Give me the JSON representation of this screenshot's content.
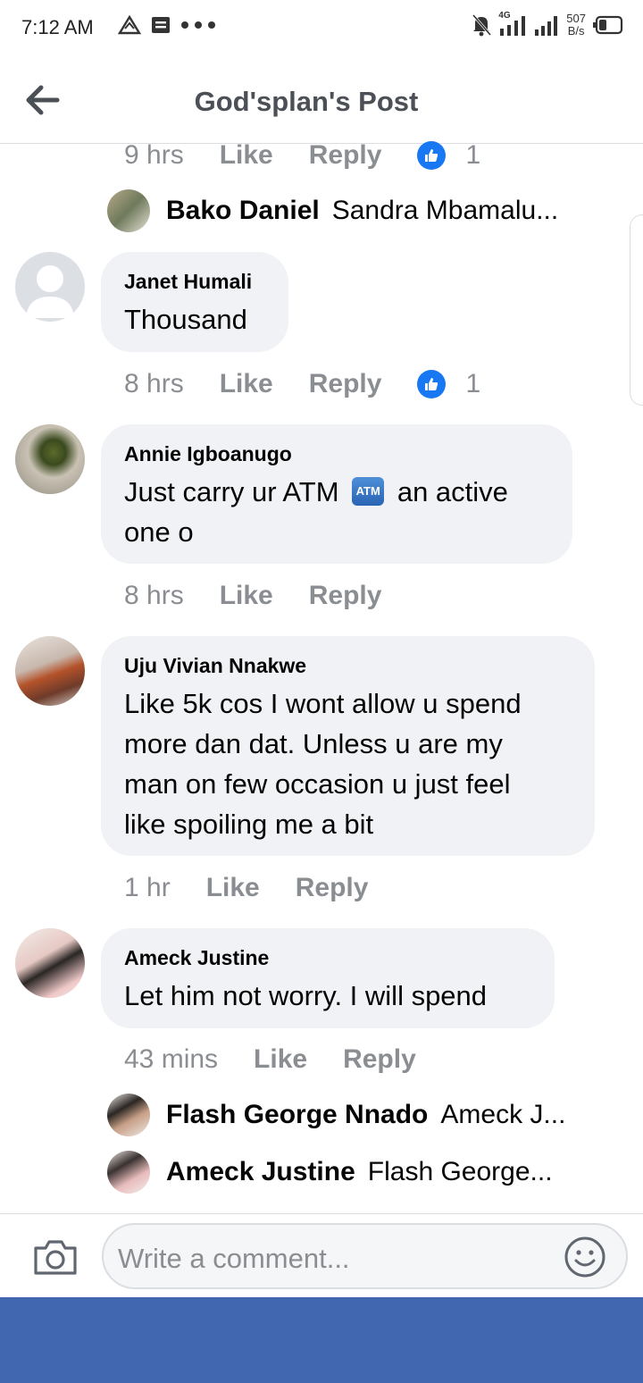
{
  "status_bar": {
    "time": "7:12 AM",
    "network_label": "4G",
    "net_speed_value": "507",
    "net_speed_unit": "B/s"
  },
  "header": {
    "title": "God'splan's Post"
  },
  "comments": [
    {
      "time": "9 hrs",
      "like": "Like",
      "reply": "Reply",
      "reaction_count": "1"
    },
    {
      "name": "Janet Humali",
      "text": "Thousand",
      "time": "8 hrs",
      "like": "Like",
      "reply": "Reply",
      "reaction_count": "1"
    },
    {
      "name": "Annie Igboanugo",
      "text_before": "Just  carry ur ATM",
      "emoji_label": "ATM",
      "text_after": "an active",
      "text_line2": "one o",
      "time": "8 hrs",
      "like": "Like",
      "reply": "Reply"
    },
    {
      "name": "Uju Vivian Nnakwe",
      "lines": [
        "Like 5k  cos  I wont allow u spend",
        "more  dan dat. Unless u are my",
        "man on few occasion  u just feel",
        "like spoiling  me  a bit"
      ],
      "time": "1 hr",
      "like": "Like",
      "reply": "Reply"
    },
    {
      "name": "Ameck Justine",
      "text": "Let him not worry. I will spend",
      "time": "43 mins",
      "like": "Like",
      "reply": "Reply"
    }
  ],
  "replies": [
    {
      "name": "Bako Daniel",
      "preview": "Sandra Mbamalu..."
    },
    {
      "name": "Flash George Nnado",
      "preview": "Ameck J..."
    },
    {
      "name": "Ameck Justine",
      "preview": "Flash George..."
    }
  ],
  "composer": {
    "placeholder": "Write a comment..."
  },
  "colors": {
    "facebook_blue": "#1877f2",
    "bubble_bg": "#f0f2f5",
    "nav_bar": "#4167b1",
    "meta_gray": "#8a8d91"
  }
}
